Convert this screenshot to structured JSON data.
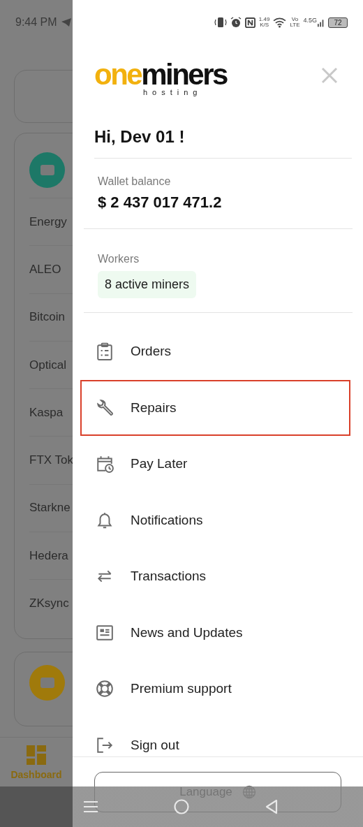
{
  "status_bar": {
    "time": "9:44 PM",
    "speed": "1.49",
    "speed_unit": "K/S",
    "volte_top": "Vo",
    "volte_bottom": "LTE",
    "network": "4.5G",
    "battery": "72"
  },
  "background": {
    "list_items": [
      "Energy",
      "ALEO",
      "Bitcoin",
      "Optical",
      "Kaspa",
      "FTX Tok",
      "Starkne",
      "Hedera",
      "ZKsync"
    ],
    "nav_label": "Dashboard"
  },
  "drawer": {
    "logo": {
      "part_1": "one",
      "part_2": "miners",
      "tagline": "hosting"
    },
    "greeting": "Hi, Dev 01 !",
    "wallet": {
      "label": "Wallet balance",
      "value": "$ 2 437 017 471.2"
    },
    "workers": {
      "label": "Workers",
      "badge": "8 active miners"
    },
    "menu": [
      {
        "label": "Orders",
        "selected": false
      },
      {
        "label": "Repairs",
        "selected": true
      },
      {
        "label": "Pay Later",
        "selected": false
      },
      {
        "label": "Notifications",
        "selected": false
      },
      {
        "label": "Transactions",
        "selected": false
      },
      {
        "label": "News and Updates",
        "selected": false
      },
      {
        "label": "Premium support",
        "selected": false
      },
      {
        "label": "Sign out",
        "selected": false
      }
    ],
    "language_button": "Language"
  }
}
